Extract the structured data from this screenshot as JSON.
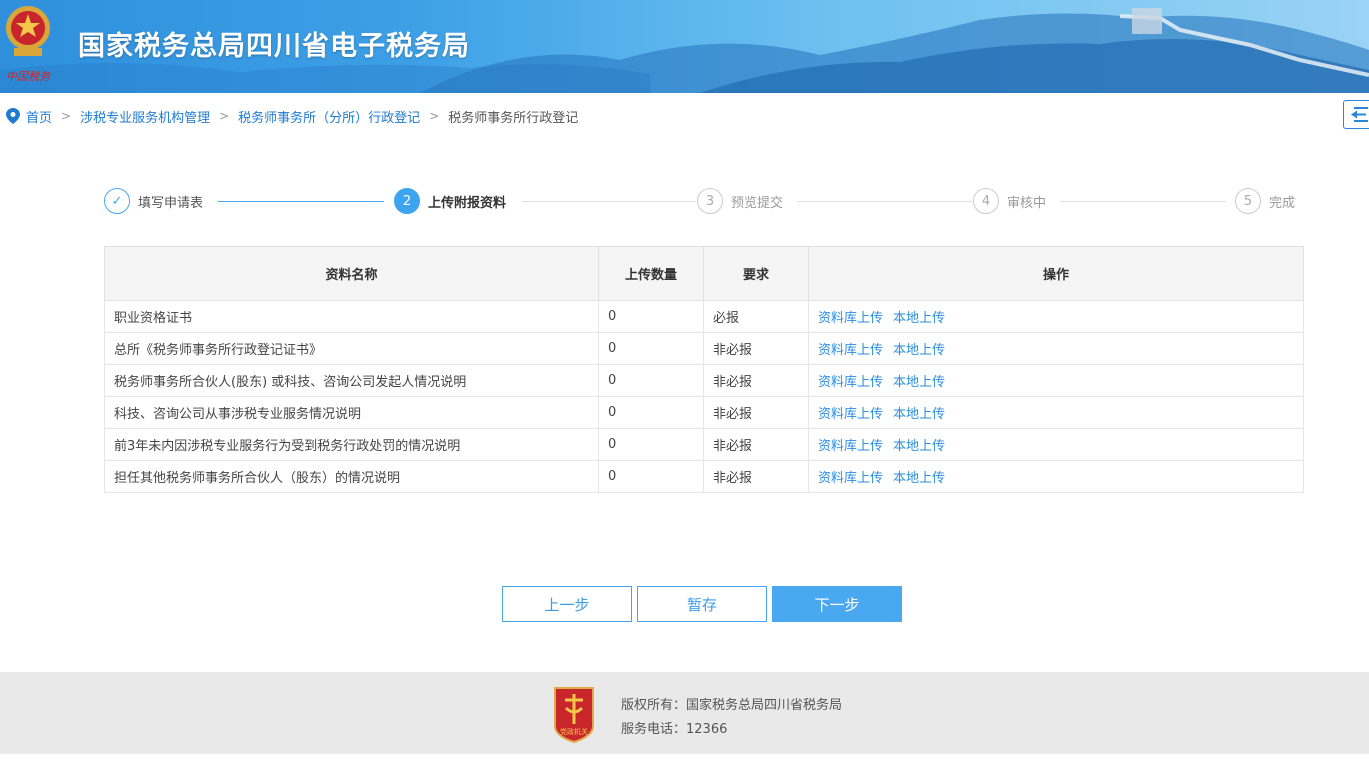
{
  "header": {
    "site_title": "国家税务总局四川省电子税务局",
    "emblem_label": "中国税务"
  },
  "breadcrumb": {
    "items": [
      "首页",
      "涉税专业服务机构管理",
      "税务师事务所（分所）行政登记"
    ],
    "current": "税务师事务所行政登记"
  },
  "steps": [
    {
      "num": "✓",
      "label": "填写申请表",
      "state": "done"
    },
    {
      "num": "2",
      "label": "上传附报资料",
      "state": "active"
    },
    {
      "num": "3",
      "label": "预览提交",
      "state": "pending"
    },
    {
      "num": "4",
      "label": "审核中",
      "state": "pending"
    },
    {
      "num": "5",
      "label": "完成",
      "state": "pending"
    }
  ],
  "table": {
    "headers": [
      "资料名称",
      "上传数量",
      "要求",
      "操作"
    ],
    "rows": [
      {
        "name": "职业资格证书",
        "count": "0",
        "req": "必报"
      },
      {
        "name": "总所《税务师事务所行政登记证书》",
        "count": "0",
        "req": "非必报"
      },
      {
        "name": "税务师事务所合伙人(股东) 或科技、咨询公司发起人情况说明",
        "count": "0",
        "req": "非必报"
      },
      {
        "name": "科技、咨询公司从事涉税专业服务情况说明",
        "count": "0",
        "req": "非必报"
      },
      {
        "name": "前3年未内因涉税专业服务行为受到税务行政处罚的情况说明",
        "count": "0",
        "req": "非必报"
      },
      {
        "name": "担任其他税务师事务所合伙人（股东）的情况说明",
        "count": "0",
        "req": "非必报"
      }
    ],
    "action_library": "资料库上传",
    "action_local": "本地上传"
  },
  "buttons": {
    "prev": "上一步",
    "save": "暂存",
    "next": "下一步"
  },
  "footer": {
    "copyright": "版权所有：国家税务总局四川省税务局",
    "phone": "服务电话：12366",
    "logo_label": "党政机关"
  },
  "colors": {
    "accent": "#3da5ef",
    "link": "#1f7bd0",
    "footer_bg": "#e9e9e9"
  }
}
